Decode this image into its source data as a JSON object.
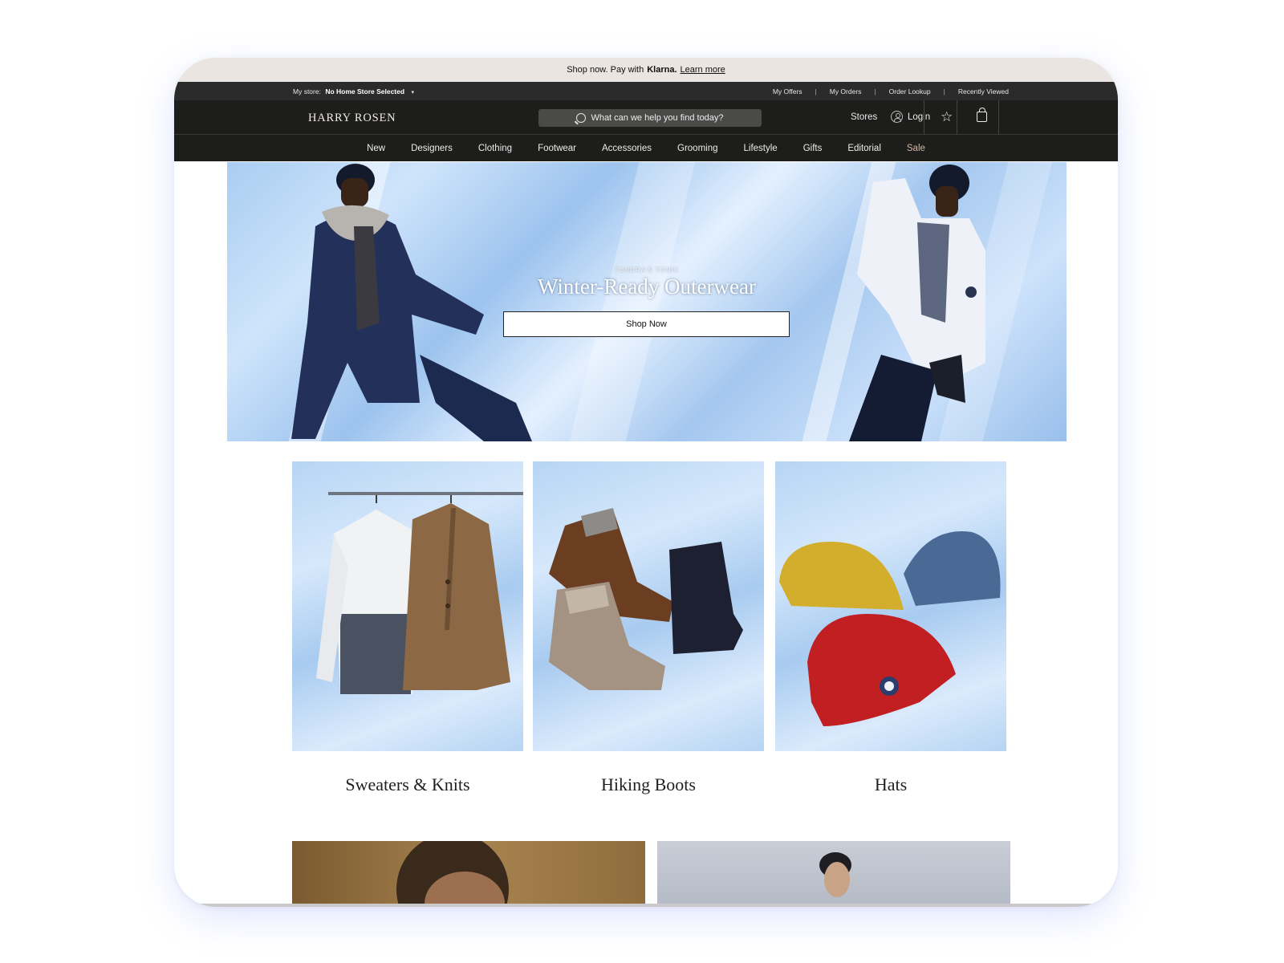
{
  "promo": {
    "text": "Shop now. Pay with",
    "brand": "Klarna.",
    "link": "Learn more"
  },
  "utility": {
    "store_label": "My store:",
    "store_value": "No Home Store Selected",
    "caret": "▾",
    "links": [
      "My Offers",
      "My Orders",
      "Order Lookup",
      "Recently Viewed"
    ],
    "separator": "|"
  },
  "header": {
    "logo": "HARRY ROSEN",
    "search_placeholder": "What can we help you find today?",
    "stores": "Stores",
    "login": "Login",
    "star_glyph": "☆"
  },
  "nav": {
    "items": [
      "New",
      "Designers",
      "Clothing",
      "Footwear",
      "Accessories",
      "Grooming",
      "Lifestyle",
      "Gifts",
      "Editorial",
      "Sale"
    ]
  },
  "hero": {
    "eyebrow": "TUNDRA'S TONIC",
    "title": "Winter-Ready Outerwear",
    "cta": "Shop Now"
  },
  "categories": [
    {
      "label": "Sweaters & Knits"
    },
    {
      "label": "Hiking Boots"
    },
    {
      "label": "Hats"
    }
  ],
  "colors": {
    "promo_bg": "#ebe5e1",
    "header_bg": "#1d1d1b",
    "utility_bg": "#2b2b2b",
    "sale_accent": "#d4b8a6",
    "hero_sky": "#a9cdf1"
  }
}
